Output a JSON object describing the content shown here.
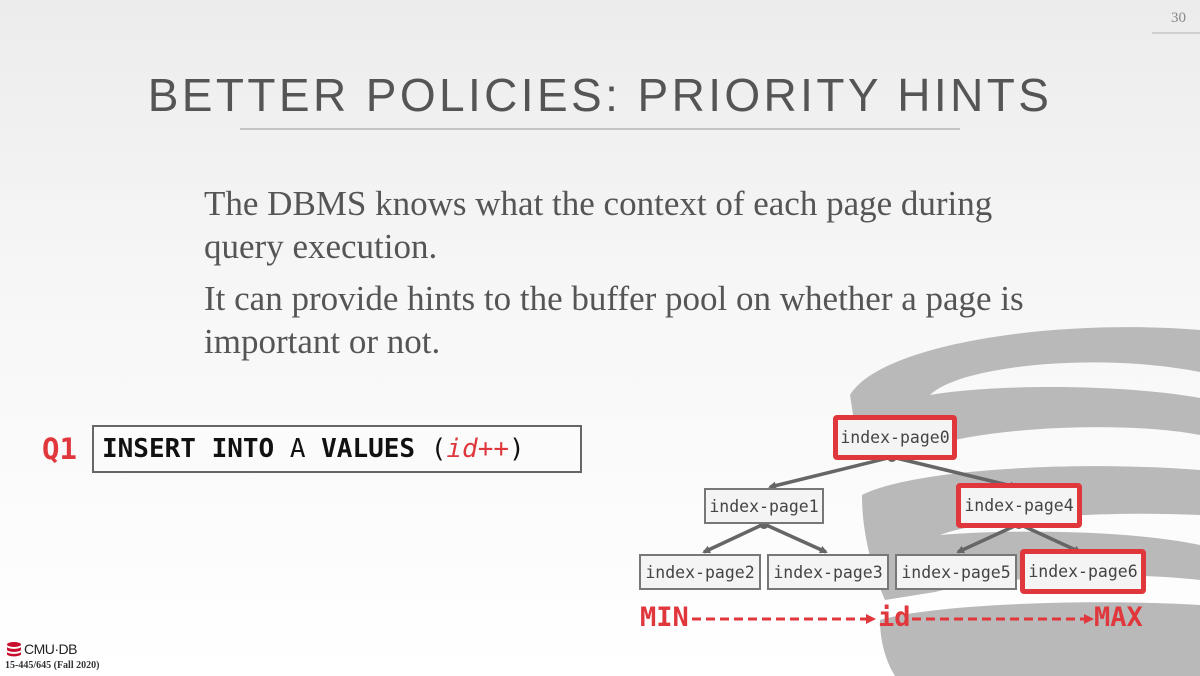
{
  "slide": {
    "number": "30",
    "title": "BETTER POLICIES: PRIORITY HINTS",
    "bullets": [
      "The DBMS knows what the context of each page during query execution.",
      "It can provide hints to the buffer pool on whether a page is important or not."
    ]
  },
  "query": {
    "label": "Q1",
    "kw_insert": "INSERT INTO",
    "table": " A ",
    "kw_values": "VALUES",
    "open": " (",
    "expr": "id++",
    "close": ")"
  },
  "tree": {
    "nodes": [
      {
        "label": "index-page0",
        "highlighted": true
      },
      {
        "label": "index-page1",
        "highlighted": false
      },
      {
        "label": "index-page4",
        "highlighted": true
      },
      {
        "label": "index-page2",
        "highlighted": false
      },
      {
        "label": "index-page3",
        "highlighted": false
      },
      {
        "label": "index-page5",
        "highlighted": false
      },
      {
        "label": "index-page6",
        "highlighted": true
      }
    ],
    "axis": {
      "min": "MIN",
      "mid": "id",
      "max": "MAX"
    }
  },
  "colors": {
    "accent": "#e0373d",
    "text": "#555555",
    "node_border": "#777777"
  },
  "footer": {
    "logo_text": "CMU·DB",
    "course": "15-445/645 (Fall 2020)"
  }
}
